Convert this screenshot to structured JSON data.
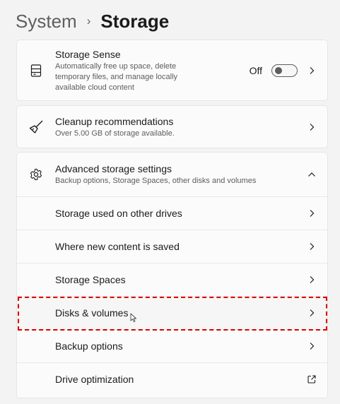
{
  "breadcrumb": {
    "parent": "System",
    "separator": "›",
    "current": "Storage"
  },
  "storage_sense": {
    "title": "Storage Sense",
    "description_lines": [
      "Automatically free up space, delete",
      "temporary files, and manage locally",
      "available cloud content"
    ],
    "toggle_label": "Off",
    "toggle_on": false
  },
  "cleanup": {
    "title": "Cleanup recommendations",
    "description": "Over 5.00 GB of storage available."
  },
  "advanced": {
    "title": "Advanced storage settings",
    "description": "Backup options, Storage Spaces, other disks and volumes",
    "expanded": true,
    "items": [
      {
        "label": "Storage used on other drives",
        "icon": "chevron-right"
      },
      {
        "label": "Where new content is saved",
        "icon": "chevron-right"
      },
      {
        "label": "Storage Spaces",
        "icon": "chevron-right"
      },
      {
        "label": "Disks & volumes",
        "icon": "chevron-right",
        "highlighted": true
      },
      {
        "label": "Backup options",
        "icon": "chevron-right"
      },
      {
        "label": "Drive optimization",
        "icon": "external-link"
      }
    ]
  },
  "colors": {
    "highlight": "#d90000",
    "background": "#f3f3f3",
    "card": "#fbfbfb"
  }
}
